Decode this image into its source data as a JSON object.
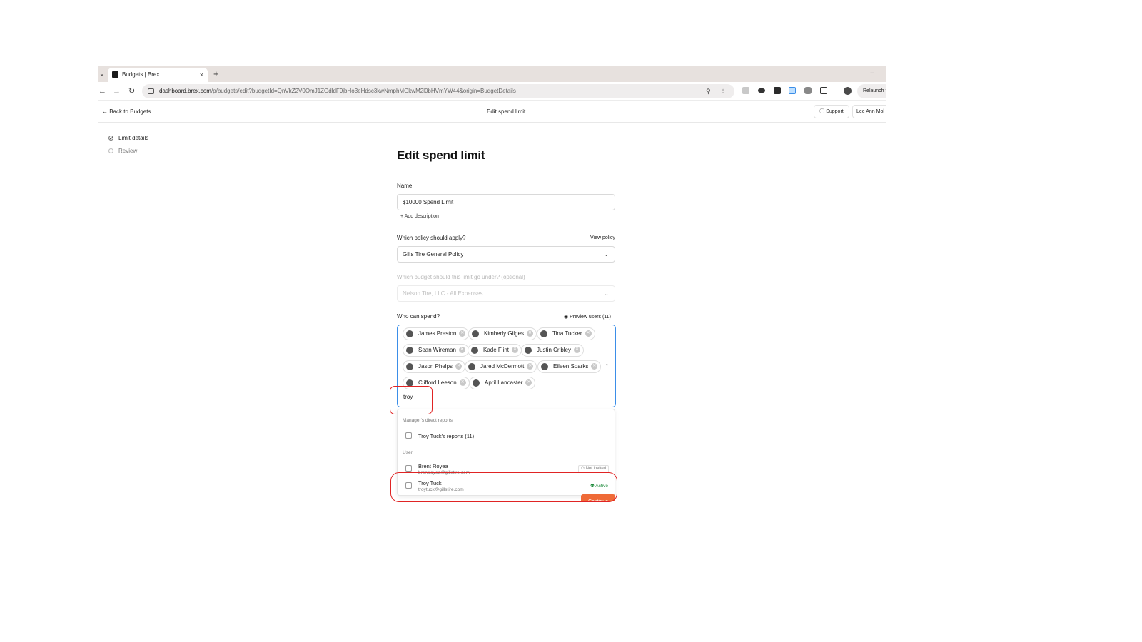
{
  "browser": {
    "tab_title": "Budgets | Brex",
    "tab_close": "×",
    "new_tab": "+",
    "minimize": "–",
    "url_host": "dashboard.brex.com",
    "url_path": "/p/budgets/edit?budgetId=QnVkZ2V0OmJ1ZGdldF9jbHo3eHdsc3kwNmphMGkwM2l0bHVmYW44&origin=BudgetDetails",
    "relaunch_label": "Relaunch t",
    "nav_back": "←",
    "nav_forward": "→",
    "nav_reload": "↻",
    "tab_menu": "⌄"
  },
  "header": {
    "back_label": "← Back to Budgets",
    "title": "Edit spend limit",
    "support_label": "Support",
    "user_label": "Lee Ann Mol"
  },
  "steps": [
    {
      "label": "Limit details"
    },
    {
      "label": "Review"
    }
  ],
  "form": {
    "heading": "Edit spend limit",
    "name_label": "Name",
    "name_value": "$10000 Spend Limit",
    "add_description": "+  Add description",
    "policy_label": "Which policy should apply?",
    "view_policy": "View policy",
    "policy_value": "Gills Tire General Policy",
    "budget_label": "Which budget should this limit go under? (optional)",
    "budget_value": "Nelson Tire, LLC - All Expenses",
    "who_label": "Who can spend?",
    "preview_users": "Preview users (11)",
    "chips": [
      {
        "name": "James Preston"
      },
      {
        "name": "Kimberly Gilges"
      },
      {
        "name": "Tina Tucker"
      },
      {
        "name": "Sean Wireman"
      },
      {
        "name": "Kade Flint"
      },
      {
        "name": "Justin Cribley"
      },
      {
        "name": "Jason Phelps"
      },
      {
        "name": "Jared McDermott"
      },
      {
        "name": "Eileen Sparks"
      },
      {
        "name": "Clifford Leeson"
      },
      {
        "name": "April Lancaster"
      }
    ],
    "search_value": "troy",
    "continue_label": "Continue"
  },
  "dropdown": {
    "section1": "Manager's direct reports",
    "reports_option": "Troy Tuck's reports (11)",
    "section2": "User",
    "users": [
      {
        "name": "Brent Royea",
        "email": "brentroyea@gillstire.com",
        "status": "Not invited"
      },
      {
        "name": "Troy Tuck",
        "email": "troytuck@gillstire.com",
        "status": "Active"
      }
    ]
  },
  "colors": {
    "accent_blue": "#3b8ee8",
    "continue_orange": "#ef6a37",
    "active_green": "#1d8a3b",
    "annotation_red": "#e02424"
  }
}
